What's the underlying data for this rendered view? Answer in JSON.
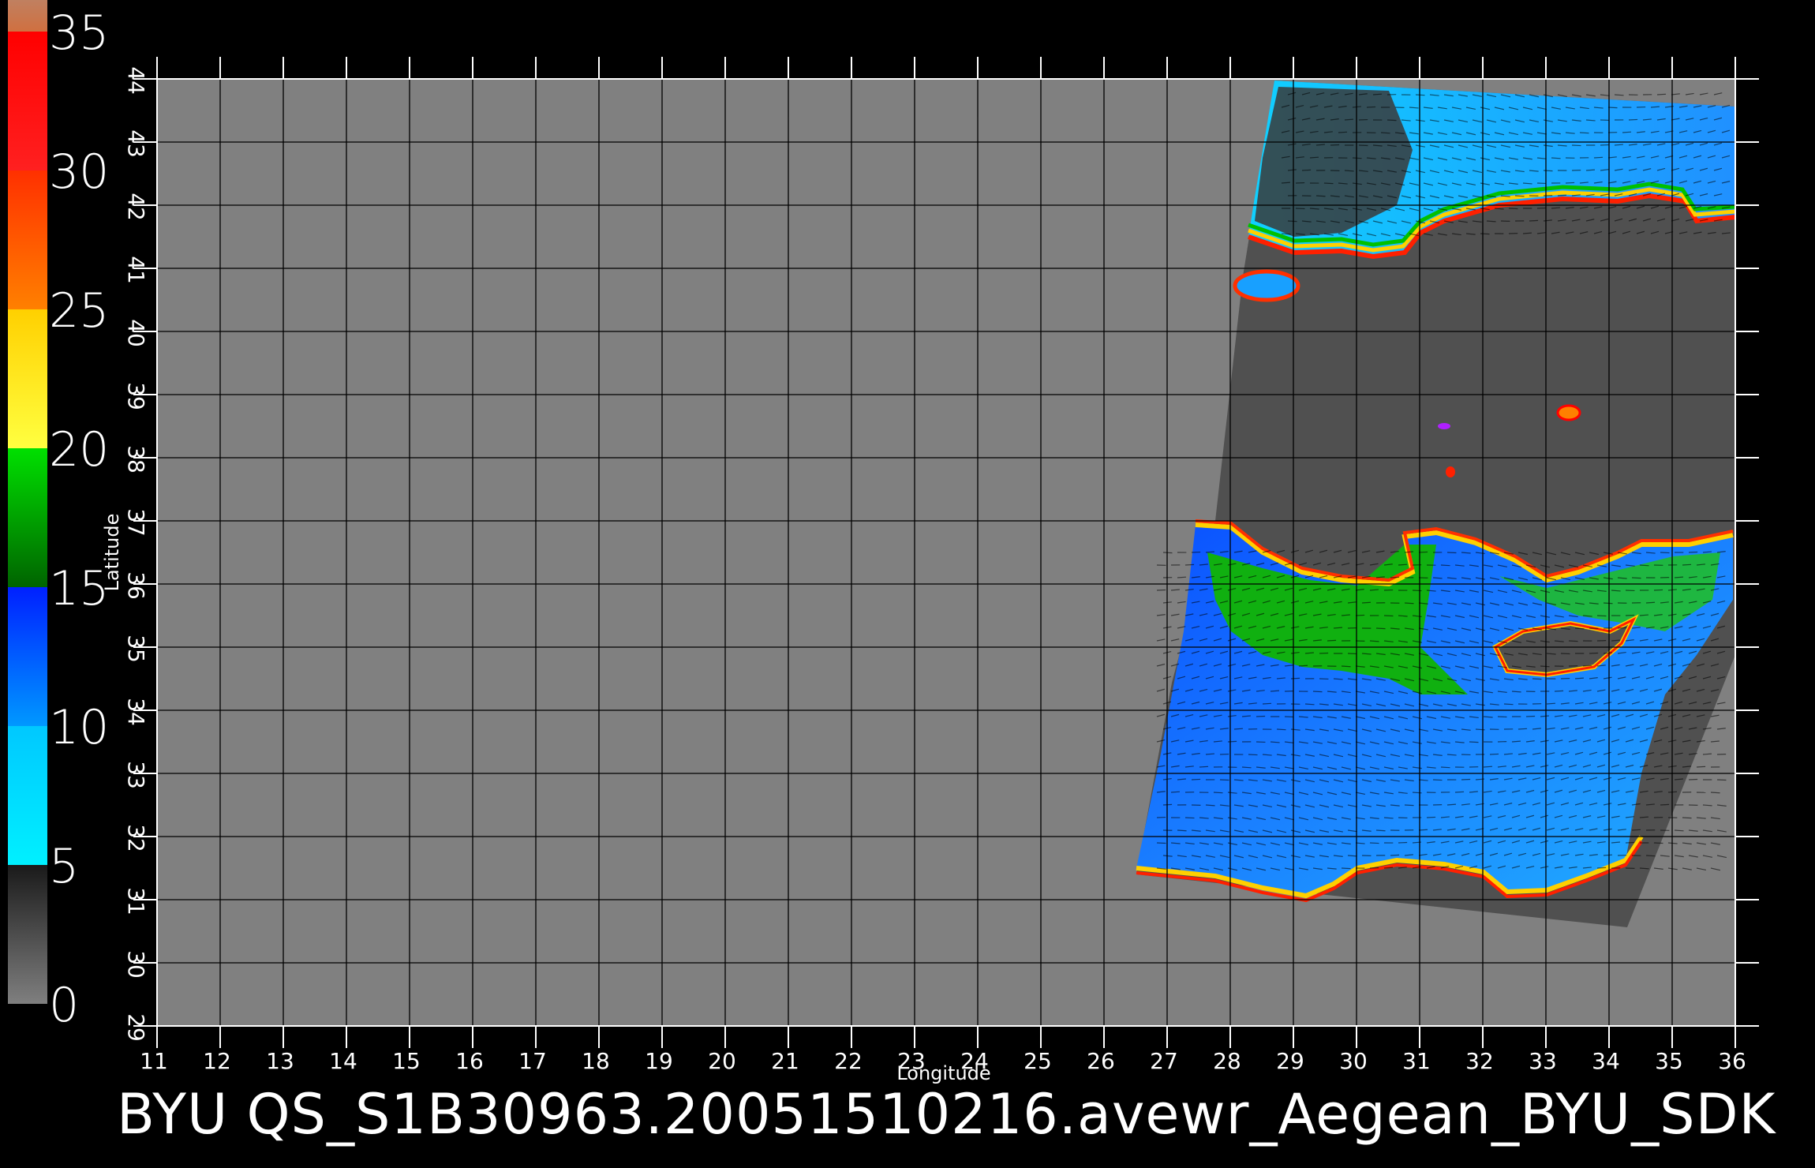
{
  "footer": {
    "title": "BYU  QS_S1B30963.20051510216.avewr_Aegean_BYU_SDK"
  },
  "colorbar": {
    "labels": [
      "35",
      "30",
      "25",
      "20",
      "15",
      "10",
      "5",
      "0"
    ],
    "segments": [
      {
        "from": 0,
        "to": 5,
        "color_top": "#1a1a1a",
        "color_bottom": "#7f7f7f"
      },
      {
        "from": 5,
        "to": 10,
        "color_top": "#00c8ff",
        "color_bottom": "#00f0ff"
      },
      {
        "from": 10,
        "to": 15,
        "color_top": "#0020ff",
        "color_bottom": "#0098ff"
      },
      {
        "from": 15,
        "to": 20,
        "color_top": "#00e000",
        "color_bottom": "#006400"
      },
      {
        "from": 20,
        "to": 25,
        "color_top": "#ffd000",
        "color_bottom": "#ffff40"
      },
      {
        "from": 25,
        "to": 30,
        "color_top": "#ff3000",
        "color_bottom": "#ff8000"
      },
      {
        "from": 30,
        "to": 35,
        "color_top": "#ff0000",
        "color_bottom": "#ff2020"
      },
      {
        "from": 35,
        "to": 37,
        "color_top": "#c08060",
        "color_bottom": "#d07040"
      }
    ]
  },
  "map": {
    "x_label": "Longitude",
    "y_label": "Latitude",
    "lon_ticks": [
      "11",
      "12",
      "13",
      "14",
      "15",
      "16",
      "17",
      "18",
      "19",
      "20",
      "21",
      "22",
      "23",
      "24",
      "25",
      "26",
      "27",
      "28",
      "29",
      "30",
      "31",
      "32",
      "33",
      "34",
      "35",
      "36"
    ],
    "lat_ticks": [
      "29",
      "30",
      "31",
      "32",
      "33",
      "34",
      "35",
      "36",
      "37",
      "38",
      "39",
      "40",
      "41",
      "42",
      "43",
      "44"
    ],
    "background_color": "#808080",
    "swath_color": "#505050",
    "grid_color": "#000000"
  }
}
